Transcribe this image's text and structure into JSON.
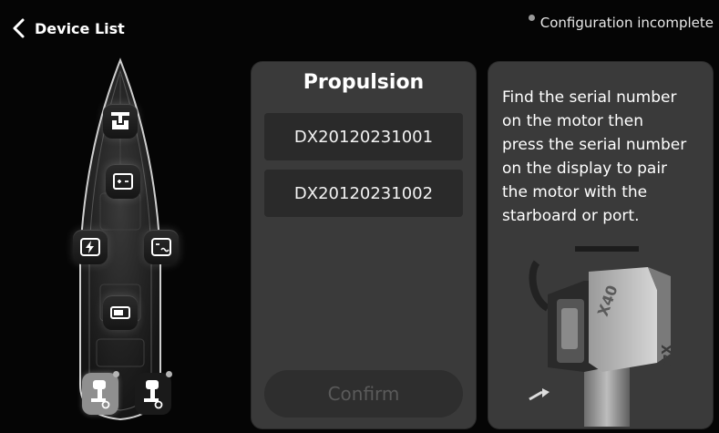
{
  "header": {
    "back_label": "Device List",
    "status_text": "Configuration incomplete",
    "status_dot_color": "#9a9a9a"
  },
  "boat": {
    "devices": [
      {
        "name": "propulsion-hub",
        "icon": "propulsion-icon"
      },
      {
        "name": "battery-plus-minus",
        "icon": "battery-terminals-icon"
      },
      {
        "name": "charger",
        "icon": "lightning-icon"
      },
      {
        "name": "dc-ac",
        "icon": "power-converter-icon"
      },
      {
        "name": "display",
        "icon": "display-icon"
      }
    ],
    "motors": [
      {
        "name": "port-motor",
        "state": "selected",
        "icon": "outboard-motor-icon"
      },
      {
        "name": "starboard-motor",
        "state": "unselected",
        "icon": "outboard-motor-icon"
      }
    ]
  },
  "propulsion": {
    "title": "Propulsion",
    "serials": [
      "DX20120231001",
      "DX20120231002"
    ],
    "confirm_label": "Confirm"
  },
  "info": {
    "lines": [
      "Find the serial number",
      "on the motor then",
      "press the serial number",
      "on the display to pair",
      "the motor with the",
      "starboard or port."
    ],
    "illustration": "x40-motor-illustration"
  },
  "colors": {
    "panel": "#3a3a3a",
    "button": "#2a2a2a",
    "selected_motor": "#8f8f8f"
  }
}
